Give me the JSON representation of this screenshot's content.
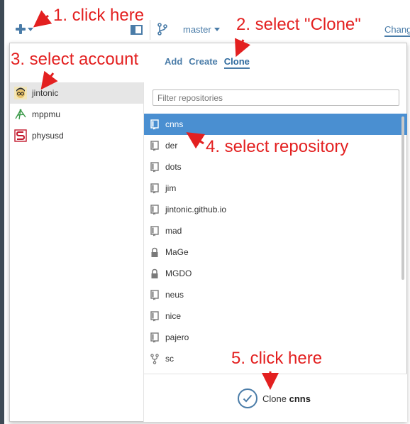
{
  "toolbar": {
    "branch_label": "master",
    "changes_tab": "Chang"
  },
  "popover": {
    "tabs": [
      {
        "label": "Add",
        "active": false
      },
      {
        "label": "Create",
        "active": false
      },
      {
        "label": "Clone",
        "active": true
      }
    ],
    "accounts": [
      {
        "name": "jintonic",
        "selected": true
      },
      {
        "name": "mppmu",
        "selected": false
      },
      {
        "name": "physusd",
        "selected": false
      }
    ],
    "filter": {
      "placeholder": "Filter repositories",
      "value": ""
    },
    "repositories": [
      {
        "name": "cnns",
        "icon": "repo-icon",
        "selected": true
      },
      {
        "name": "der",
        "icon": "repo-icon",
        "selected": false
      },
      {
        "name": "dots",
        "icon": "repo-icon",
        "selected": false
      },
      {
        "name": "jim",
        "icon": "repo-icon",
        "selected": false
      },
      {
        "name": "jintonic.github.io",
        "icon": "repo-icon",
        "selected": false
      },
      {
        "name": "mad",
        "icon": "repo-icon",
        "selected": false
      },
      {
        "name": "MaGe",
        "icon": "lock-icon",
        "selected": false
      },
      {
        "name": "MGDO",
        "icon": "lock-icon",
        "selected": false
      },
      {
        "name": "neus",
        "icon": "repo-icon",
        "selected": false
      },
      {
        "name": "nice",
        "icon": "repo-icon",
        "selected": false
      },
      {
        "name": "pajero",
        "icon": "repo-icon",
        "selected": false
      },
      {
        "name": "sc",
        "icon": "fork-icon",
        "selected": false
      }
    ],
    "clone_button": {
      "prefix": "Clone",
      "repo": "cnns"
    }
  },
  "annotations": {
    "step1": "1. click here",
    "step2": "2. select \"Clone\"",
    "step3": "3. select account",
    "step4": "4. select repository",
    "step5": "5. click here"
  },
  "colors": {
    "accent": "#4a7ca8",
    "selection": "#4a8fd1",
    "annotation": "#e32020"
  }
}
